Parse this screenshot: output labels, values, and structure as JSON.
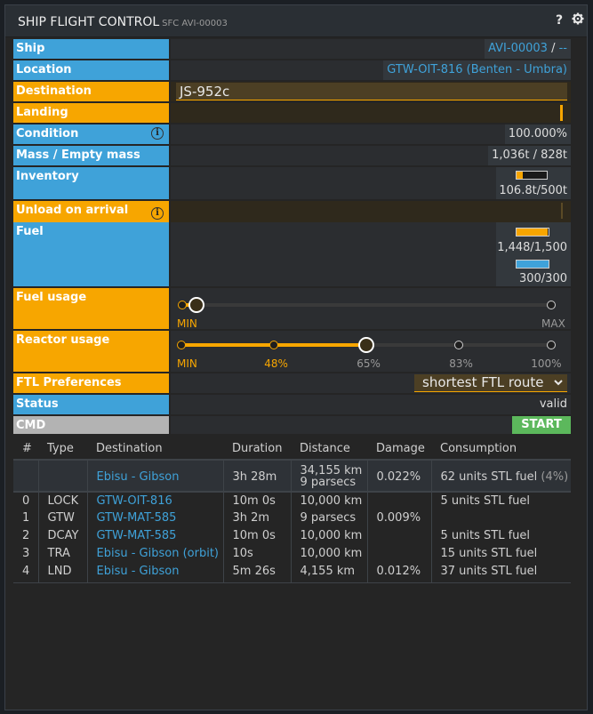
{
  "window": {
    "title": "SHIP FLIGHT CONTROL",
    "subtitle": "SFC AVI-00003",
    "help_icon": "?",
    "settings_icon": "gear-icon"
  },
  "fields": {
    "ship": {
      "label": "Ship",
      "value": "AVI-00003",
      "separator": "/",
      "extra": "--"
    },
    "location": {
      "label": "Location",
      "value": "GTW-OIT-816 (Benten - Umbra)"
    },
    "destination": {
      "label": "Destination",
      "value": "JS-952c"
    },
    "landing": {
      "label": "Landing"
    },
    "condition": {
      "label": "Condition",
      "info": "i",
      "value": "100.000%"
    },
    "mass": {
      "label": "Mass / Empty mass",
      "value": "1,036t / 828t"
    },
    "inventory": {
      "label": "Inventory",
      "value": "106.8t/500t",
      "fill_fraction": 0.21
    },
    "unload": {
      "label": "Unload on arrival",
      "info": "i"
    },
    "fuel": {
      "label": "Fuel",
      "stl": {
        "value": "1,448/1,500",
        "fill_fraction": 0.965,
        "color": "#f7a600"
      },
      "ftl": {
        "value": "300/300",
        "fill_fraction": 1.0,
        "color": "#3fa2d9"
      }
    },
    "fuel_usage": {
      "label": "Fuel usage",
      "min_label": "MIN",
      "max_label": "MAX",
      "level": 0.04
    },
    "reactor_usage": {
      "label": "Reactor usage",
      "stops": [
        "MIN",
        "48%",
        "65%",
        "83%",
        "100%"
      ],
      "selected_index": 2,
      "active_label_index": 1
    },
    "ftl_preferences": {
      "label": "FTL Preferences",
      "selected": "shortest FTL route"
    },
    "status": {
      "label": "Status",
      "value": "valid"
    },
    "cmd": {
      "label": "CMD",
      "button": "START"
    }
  },
  "colors": {
    "blue_label": "#3fa2d9",
    "orange_label": "#f7a600",
    "gray_label": "#b3b3b3",
    "start_button": "#5cb85c",
    "link": "#3fa2d9"
  },
  "route": {
    "columns": [
      "#",
      "Type",
      "Destination",
      "Duration",
      "Distance",
      "Damage",
      "Consumption"
    ],
    "summary": {
      "destination": "Ebisu - Gibson",
      "duration": "3h 28m",
      "distance_line1": "34,155 km",
      "distance_line2": "9 parsecs",
      "damage": "0.022%",
      "consumption": "62 units STL fuel",
      "consumption_pct": "(4%)"
    },
    "rows": [
      {
        "num": "0",
        "type": "LOCK",
        "destination": "GTW-OIT-816",
        "duration": "10m 0s",
        "distance": "10,000 km",
        "damage": "",
        "consumption": "5 units STL fuel"
      },
      {
        "num": "1",
        "type": "GTW",
        "destination": "GTW-MAT-585",
        "duration": "3h 2m",
        "distance": "9 parsecs",
        "damage": "0.009%",
        "consumption": ""
      },
      {
        "num": "2",
        "type": "DCAY",
        "destination": "GTW-MAT-585",
        "duration": "10m 0s",
        "distance": "10,000 km",
        "damage": "",
        "consumption": "5 units STL fuel"
      },
      {
        "num": "3",
        "type": "TRA",
        "destination": "Ebisu - Gibson (orbit)",
        "duration": "10s",
        "distance": "10,000 km",
        "damage": "",
        "consumption": "15 units STL fuel"
      },
      {
        "num": "4",
        "type": "LND",
        "destination": "Ebisu - Gibson",
        "duration": "5m 26s",
        "distance": "4,155 km",
        "damage": "0.012%",
        "consumption": "37 units STL fuel"
      }
    ]
  }
}
